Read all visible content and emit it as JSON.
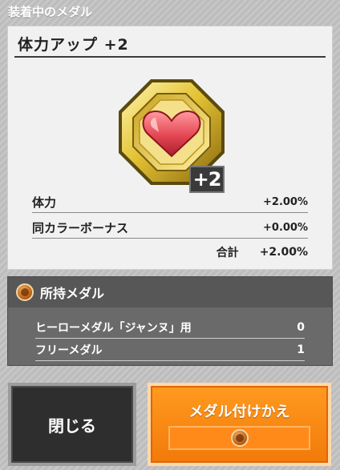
{
  "header": {
    "title": "装着中のメダル"
  },
  "equipped": {
    "name": "体力アップ +2",
    "badge": "+2",
    "icon": "heart-medal-icon",
    "stats": [
      {
        "label": "体力",
        "value": "+2.00%"
      },
      {
        "label": "同カラーボーナス",
        "value": "+0.00%"
      }
    ],
    "total_label": "合計",
    "total_value": "+2.00%"
  },
  "owned": {
    "title": "所持メダル",
    "icon": "medal-coin-icon",
    "rows": [
      {
        "label": "ヒーローメダル「ジャンヌ」用",
        "value": "0"
      },
      {
        "label": "フリーメダル",
        "value": "1"
      }
    ]
  },
  "buttons": {
    "close_label": "閉じる",
    "change_label": "メダル付けかえ"
  },
  "colors": {
    "accent": "#f27a0a",
    "panel_dark": "#575757",
    "gold": "#d6b62a",
    "heart": "#e0474f"
  }
}
